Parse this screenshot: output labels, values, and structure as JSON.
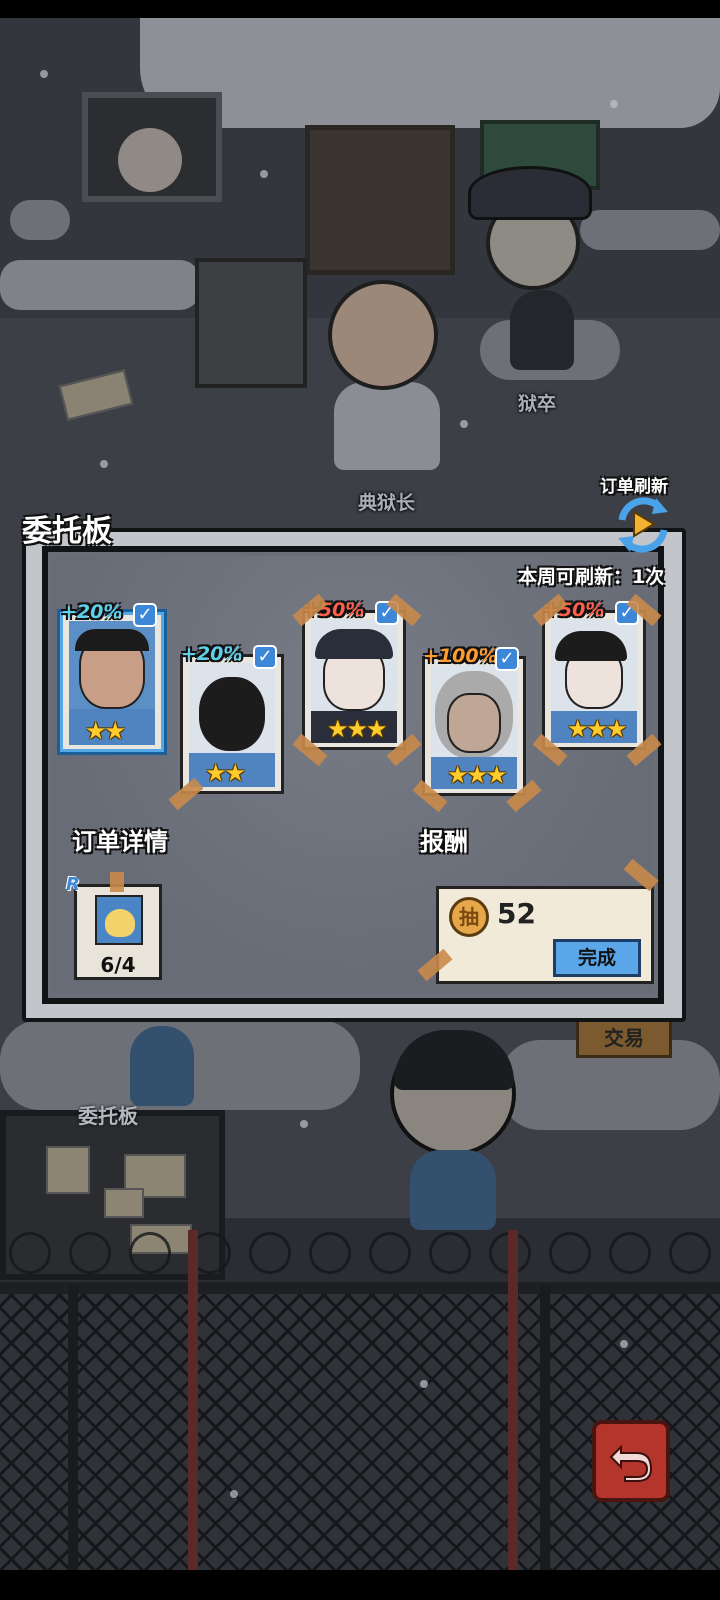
{
  "scene": {
    "npc_warden": "典狱长",
    "npc_guard": "狱卒",
    "board_label": "委托板",
    "trade_sign": "交易"
  },
  "dialog": {
    "title": "委托板",
    "refresh_label": "订单刷新",
    "refresh_count": "本周可刷新：1次",
    "order_details_label": "订单详情",
    "reward_label": "报酬",
    "cards": [
      {
        "bonus": "+20%",
        "bonus_color": "blue",
        "stars": "★★",
        "selected": true,
        "icon": "prisoner-mustache-portrait"
      },
      {
        "bonus": "+20%",
        "bonus_color": "blue",
        "stars": "★★",
        "selected": false,
        "icon": "prisoner-back-head-portrait"
      },
      {
        "bonus": "+50%",
        "bonus_color": "red",
        "stars": "★★★",
        "selected": false,
        "icon": "guard-glasses-portrait"
      },
      {
        "bonus": "+100%",
        "bonus_color": "orange",
        "stars": "★★★",
        "selected": false,
        "icon": "old-prisoner-portrait"
      },
      {
        "bonus": "+50%",
        "bonus_color": "red",
        "stars": "★★★",
        "selected": false,
        "icon": "prisoner-cap-portrait"
      }
    ],
    "order_item": {
      "rarity": "R",
      "count": "6/4",
      "icon": "comic-book-icon"
    },
    "reward": {
      "coin_glyph": "抽",
      "amount": "52",
      "complete_label": "完成"
    }
  },
  "colors": {
    "accent_blue": "#5aa6e8",
    "bonus_blue": "#5fd0e9",
    "bonus_red": "#ff5f4a",
    "bonus_orange": "#ff9b2e",
    "star": "#ffcc2e",
    "back_button": "#b3352c"
  }
}
